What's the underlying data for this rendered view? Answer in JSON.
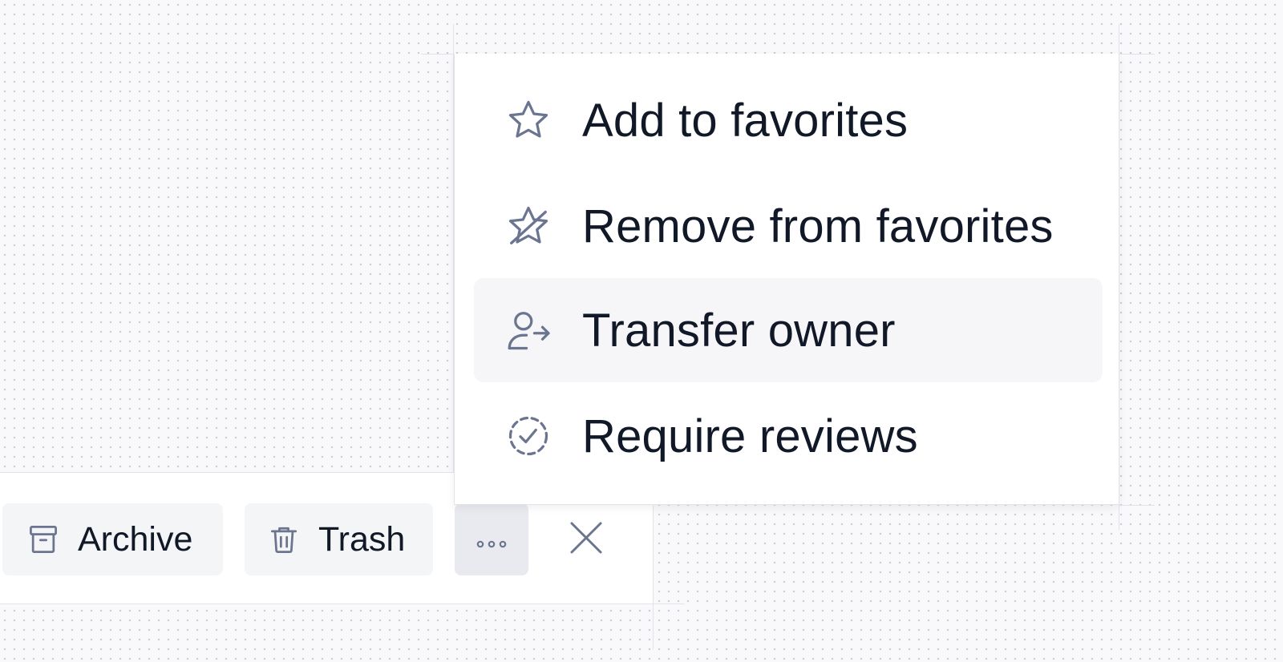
{
  "toolbar": {
    "archive_label": "Archive",
    "trash_label": "Trash",
    "more_icon": "ellipsis-horizontal-icon",
    "close_icon": "close-icon"
  },
  "menu": {
    "items": [
      {
        "label": "Add to favorites",
        "icon": "star-icon"
      },
      {
        "label": "Remove from favorites",
        "icon": "star-slash-icon"
      },
      {
        "label": "Transfer owner",
        "icon": "user-arrow-right-icon",
        "highlighted": true
      },
      {
        "label": "Require reviews",
        "icon": "dashed-circle-check-icon"
      }
    ]
  },
  "colors": {
    "icon": "#6b7590",
    "text": "#111827",
    "button_bg": "#f4f5f7",
    "more_button_bg": "#e9eaef",
    "highlight_bg": "#f6f6f9"
  }
}
